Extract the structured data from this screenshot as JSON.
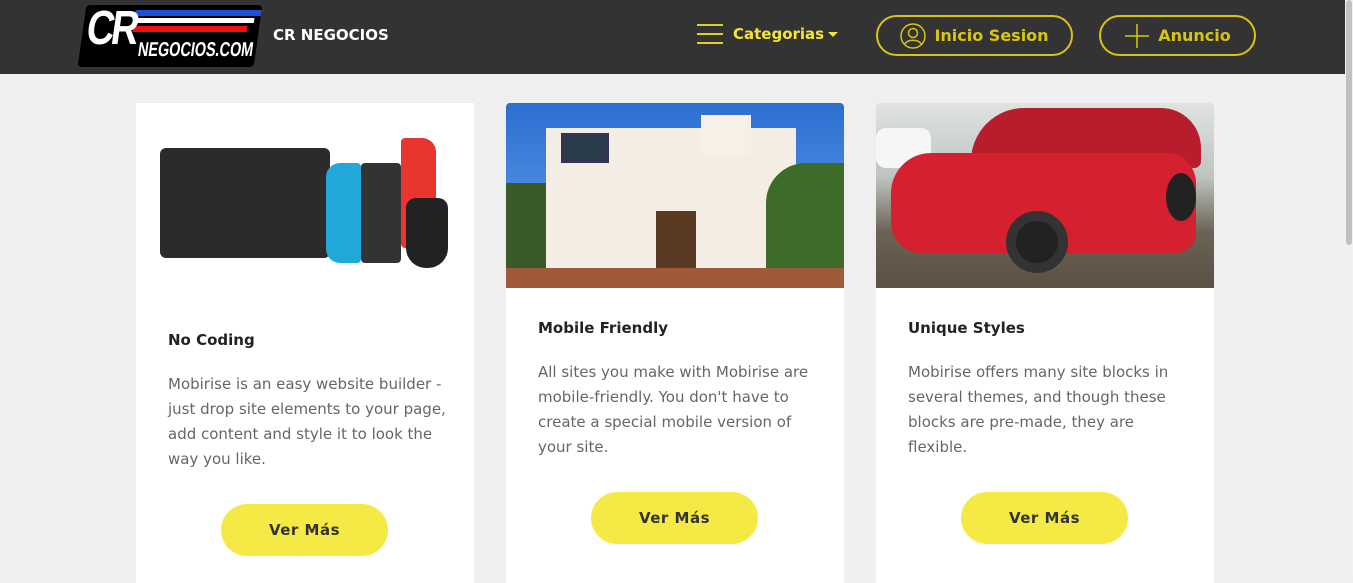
{
  "header": {
    "logo_text": "CR NEGOCIOS.COM",
    "brand": "CR NEGOCIOS",
    "categories": "Categorias",
    "login": "Inicio Sesion",
    "post_ad": "Anuncio"
  },
  "colors": {
    "accent": "#f5ea45",
    "nav_bg": "#333333",
    "outline": "#d8c412"
  },
  "cards": [
    {
      "title": "No Coding",
      "text": "Mobirise is an easy website builder - just drop site elements to your page, add content and style it to look the way you like.",
      "button": "Ver Más",
      "image": "nintendo-switch"
    },
    {
      "title": "Mobile Friendly",
      "text": "All sites you make with Mobirise are mobile-friendly. You don't have to create a special mobile version of your site.",
      "button": "Ver Más",
      "image": "house"
    },
    {
      "title": "Unique Styles",
      "text": "Mobirise offers many site blocks in several themes, and though these blocks are pre-made, they are flexible.",
      "button": "Ver Más",
      "image": "red-car"
    }
  ]
}
